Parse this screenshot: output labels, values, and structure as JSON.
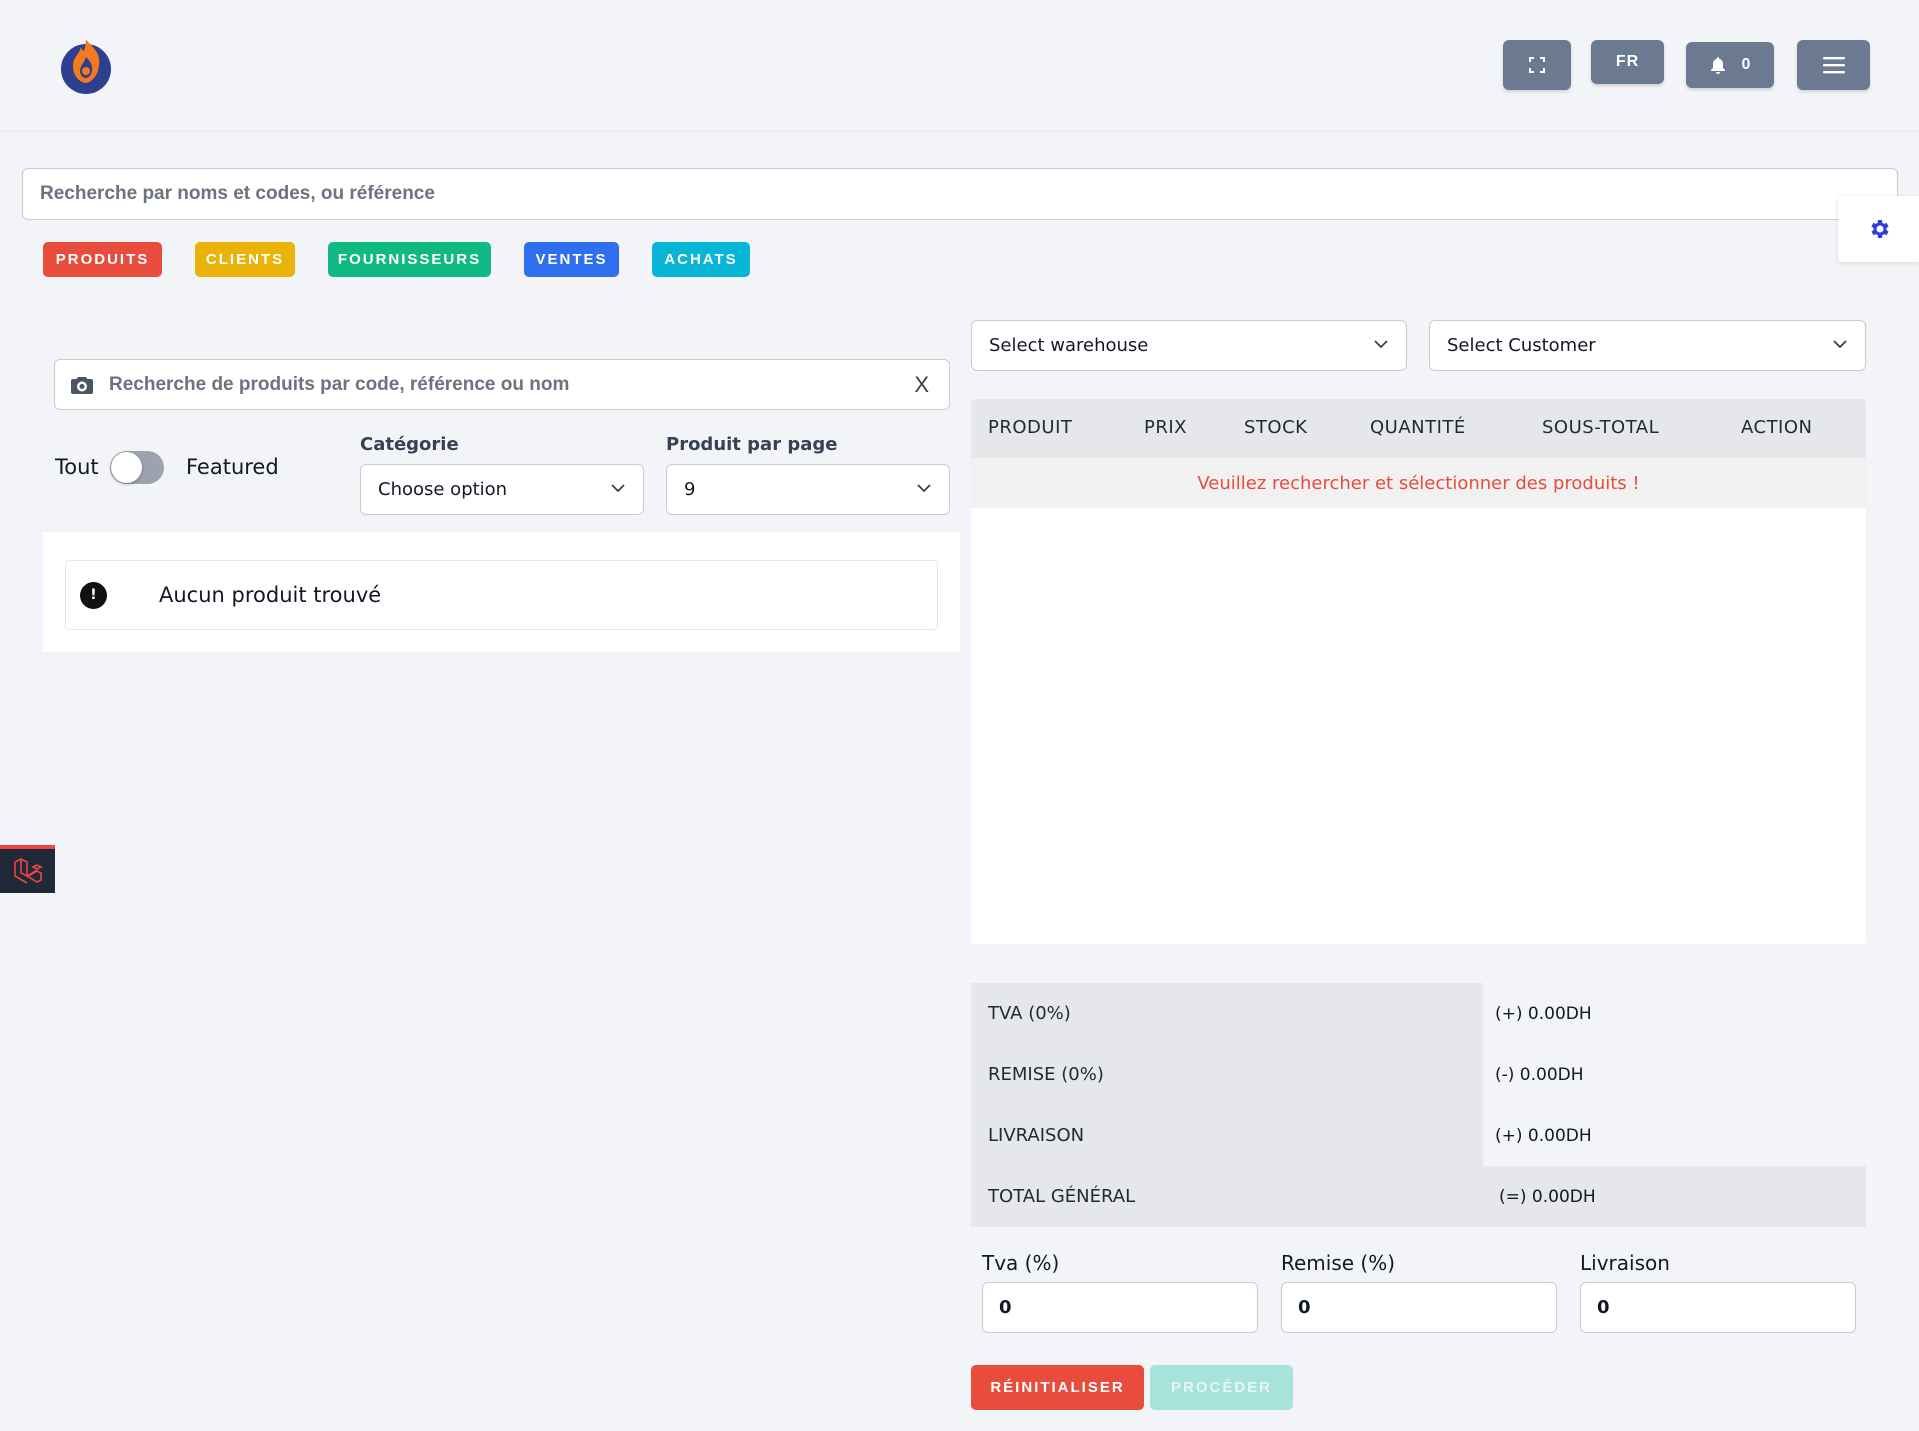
{
  "header": {
    "lang": "FR",
    "notif_count": "0"
  },
  "global_search": {
    "placeholder": "Recherche par noms et codes, ou référence"
  },
  "pills": [
    {
      "label": "PRODUITS",
      "color": "#e74c3c"
    },
    {
      "label": "CLIENTS",
      "color": "#eab308"
    },
    {
      "label": "FOURNISSEURS",
      "color": "#10b981"
    },
    {
      "label": "VENTES",
      "color": "#2f6fed"
    },
    {
      "label": "ACHATS",
      "color": "#06b6d4"
    }
  ],
  "left": {
    "product_search_placeholder": "Recherche de produits par code, référence ou nom",
    "clear_label": "X",
    "toggle_left": "Tout",
    "toggle_right": "Featured",
    "category_label": "Catégorie",
    "category_value": "Choose option",
    "per_page_label": "Produit par page",
    "per_page_value": "9",
    "empty_message": "Aucun produit trouvé"
  },
  "right": {
    "warehouse_select": "Select warehouse",
    "customer_select": "Select Customer",
    "table_headers": [
      "PRODUIT",
      "PRIX",
      "STOCK",
      "QUANTITÉ",
      "SOUS-TOTAL",
      "ACTION"
    ],
    "empty_row": "Veuillez rechercher et sélectionner des produits !"
  },
  "totals": [
    {
      "label": "TVA (0%)",
      "value": "(+) 0.00DH"
    },
    {
      "label": "REMISE (0%)",
      "value": "(-) 0.00DH"
    },
    {
      "label": "LIVRAISON",
      "value": "(+) 0.00DH"
    },
    {
      "label": "TOTAL GÉNÉRAL",
      "value": "(=) 0.00DH"
    }
  ],
  "adjustments": [
    {
      "label": "Tva (%)",
      "value": "0"
    },
    {
      "label": "Remise (%)",
      "value": "0"
    },
    {
      "label": "Livraison",
      "value": "0"
    }
  ],
  "buttons": {
    "reset": "RÉINITIALISER",
    "proceed": "PROCÉDER"
  },
  "colors": {
    "header_button": "#6b7a90",
    "danger": "#e74c3c",
    "proceed_disabled": "#a7e3da",
    "gear": "#2f3fd6"
  }
}
